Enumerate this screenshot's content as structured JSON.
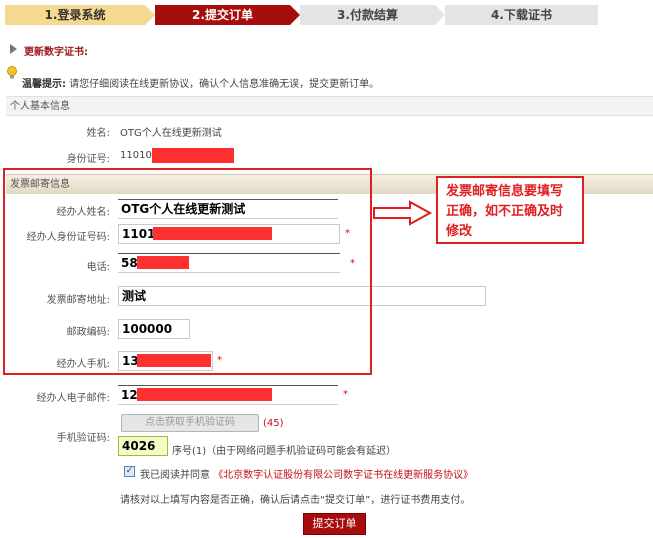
{
  "steps": [
    {
      "label": "1.登录系统",
      "state": "done"
    },
    {
      "label": "2.提交订单",
      "state": "active"
    },
    {
      "label": "3.付款结算",
      "state": "todo"
    },
    {
      "label": "4.下载证书",
      "state": "todo"
    }
  ],
  "section_title": "更新数字证书:",
  "hint": {
    "title": "温馨提示:",
    "text": "请您仔细阅读在线更新协议，确认个人信息准确无误，提交更新订单。"
  },
  "personal": {
    "header": "个人基本信息",
    "name_label": "姓名:",
    "name_value": "OTG个人在线更新测试",
    "id_label": "身份证号:",
    "id_value": "11010"
  },
  "invoice": {
    "header": "发票邮寄信息",
    "agent_name_label": "经办人姓名:",
    "agent_name_value": "OTG个人在线更新测试",
    "agent_id_label": "经办人身份证号码:",
    "agent_id_value": "1101",
    "phone_label": "电话:",
    "phone_value": "58",
    "address_label": "发票邮寄地址:",
    "address_value": "测试",
    "zip_label": "邮政编码:",
    "zip_value": "100000",
    "mobile_label": "经办人手机:",
    "mobile_value": "13",
    "email_label": "经办人电子邮件:",
    "email_value": "12",
    "sms_label": "手机验证码:",
    "sms_button": "点击获取手机验证码",
    "countdown": "(45)",
    "sms_value": "4026",
    "sms_note": "序号(1)（由于网络问题手机验证码可能会有延迟）",
    "required_mark": "*"
  },
  "agreement": {
    "prefix": "我已阅读并同意",
    "link": "《北京数字认证股份有限公司数字证书在线更新服务协议》",
    "checked": true
  },
  "confirm_text": "请核对以上填写内容是否正确，确认后请点击“提交订单”，进行证书费用支付。",
  "submit_label": "提交订单",
  "callout": {
    "text": "发票邮寄信息要填写正确，如不正确及时修改"
  },
  "colors": {
    "brand_red": "#a80d0d",
    "annotation_red": "#e02020",
    "step_done": "#f5d98e",
    "step_todo": "#e4e4e4"
  }
}
